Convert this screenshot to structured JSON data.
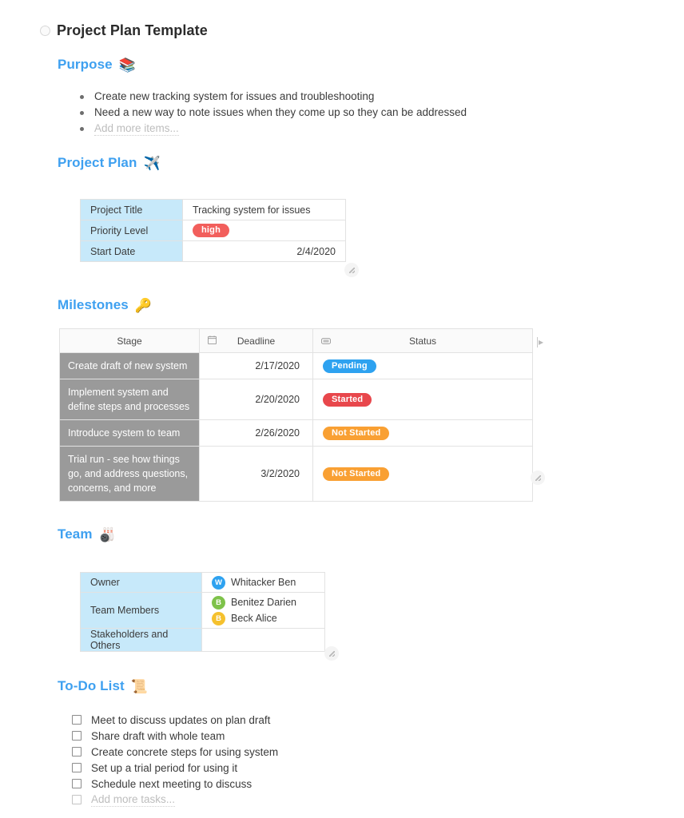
{
  "document": {
    "title": "Project Plan Template",
    "toggle_icon": "circle-toggle-icon"
  },
  "purpose": {
    "heading": "Purpose",
    "emoji": "📚",
    "emoji_name": "books-icon",
    "items": [
      "Create new tracking system for issues and troubleshooting",
      "Need a new way to note issues when they come up so they can be addressed"
    ],
    "add_more_label": "Add more items..."
  },
  "project_plan": {
    "heading": "Project Plan",
    "emoji": "✈️",
    "emoji_name": "airplane-icon",
    "rows": [
      {
        "key": "Project Title",
        "value": "Tracking system for issues",
        "type": "text"
      },
      {
        "key": "Priority Level",
        "value": "high",
        "type": "pill",
        "color": "#f25f5c"
      },
      {
        "key": "Start Date",
        "value": "2/4/2020",
        "type": "date"
      }
    ]
  },
  "milestones": {
    "heading": "Milestones",
    "emoji": "🔑",
    "emoji_name": "key-icon",
    "columns": [
      {
        "label": "Stage",
        "icon": ""
      },
      {
        "label": "Deadline",
        "icon": "calendar-icon"
      },
      {
        "label": "Status",
        "icon": "label-pill-icon"
      }
    ],
    "rows": [
      {
        "stage": "Create draft of new system",
        "deadline": "2/17/2020",
        "status": "Pending",
        "status_color": "#2ea2f0"
      },
      {
        "stage": "Implement system and define steps and processes",
        "deadline": "2/20/2020",
        "status": "Started",
        "status_color": "#e8474c"
      },
      {
        "stage": "Introduce system to team",
        "deadline": "2/26/2020",
        "status": "Not Started",
        "status_color": "#f9a033"
      },
      {
        "stage": "Trial run - see how things go, and address questions, concerns, and more",
        "deadline": "3/2/2020",
        "status": "Not Started",
        "status_color": "#f9a033"
      }
    ]
  },
  "team": {
    "heading": "Team",
    "emoji": "🎳",
    "emoji_name": "bowling-icon",
    "rows": [
      {
        "key": "Owner",
        "people": [
          {
            "initial": "W",
            "name": "Whitacker Ben",
            "color": "#2ea2f0"
          }
        ]
      },
      {
        "key": "Team Members",
        "people": [
          {
            "initial": "B",
            "name": "Benitez Darien",
            "color": "#7ec24a"
          },
          {
            "initial": "B",
            "name": "Beck Alice",
            "color": "#f5c12e"
          }
        ]
      },
      {
        "key": "Stakeholders and Others",
        "people": []
      }
    ]
  },
  "todo": {
    "heading": "To-Do List",
    "emoji": "📜",
    "emoji_name": "scroll-icon",
    "items": [
      "Meet to discuss updates on plan draft",
      "Share draft with whole team",
      "Create concrete steps for using system",
      "Set up a trial period for using it",
      "Schedule next meeting to discuss"
    ],
    "add_more_label": "Add more tasks..."
  },
  "theme": {
    "heading_blue": "#3ea0f0",
    "key_cell_blue": "#c7e9fa",
    "stage_cell_gray": "#9a9a9a"
  }
}
